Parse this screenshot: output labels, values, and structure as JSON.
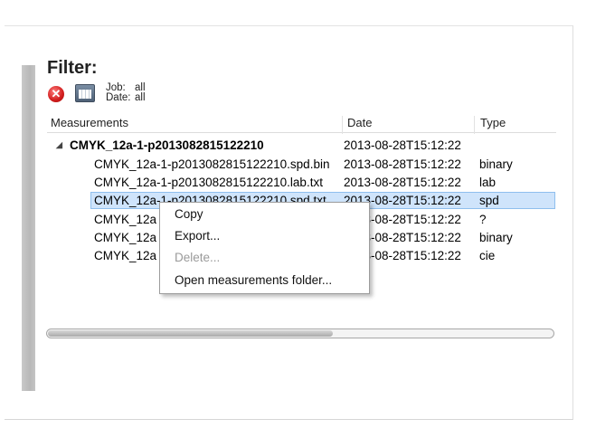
{
  "filter": {
    "title": "Filter:",
    "job_label": "Job:",
    "job_value": "all",
    "date_label": "Date:",
    "date_value": "all",
    "clear_icon": "clear-filter-icon",
    "calendar_icon": "calendar-icon"
  },
  "columns": [
    "Measurements",
    "Date",
    "Type"
  ],
  "tree": {
    "parent": {
      "toggle": "◢",
      "name": "CMYK_12a-1-p2013082815122210",
      "date": "2013-08-28T15:12:22",
      "type": ""
    },
    "children": [
      {
        "name": "CMYK_12a-1-p2013082815122210.spd.bin",
        "date": "2013-08-28T15:12:22",
        "type": "binary"
      },
      {
        "name": "CMYK_12a-1-p2013082815122210.lab.txt",
        "date": "2013-08-28T15:12:22",
        "type": "lab"
      },
      {
        "name": "CMYK_12a-1-p2013082815122210.spd.txt",
        "date": "2013-08-28T15:12:22",
        "type": "spd"
      },
      {
        "name": "CMYK_12a",
        "date": "2013-08-28T15:12:22",
        "type": "?"
      },
      {
        "name": "CMYK_12a",
        "date": "2013-08-28T15:12:22",
        "type": "binary"
      },
      {
        "name": "CMYK_12a",
        "date": "2013-08-28T15:12:22",
        "type": "cie"
      }
    ]
  },
  "context_menu": {
    "items": [
      "Copy",
      "Export...",
      "Delete...",
      "Open measurements folder..."
    ]
  }
}
